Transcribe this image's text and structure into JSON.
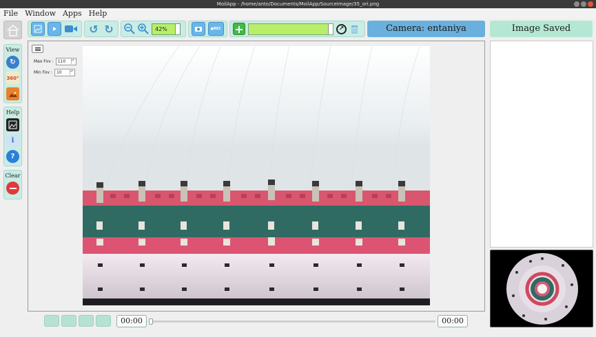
{
  "window": {
    "title": "MoilApp - /home/anto/Documents/MoilApp/SourceImage/35_ori.png"
  },
  "menubar": [
    "File",
    "Window",
    "Apps",
    "Help"
  ],
  "toolbar": {
    "zoom_value": "42%",
    "combo_value": ""
  },
  "camera_label": "Camera: entaniya",
  "image_saved_label": "Image Saved",
  "sidebar": {
    "view_title": "View",
    "help_title": "Help",
    "clear_title": "Clear",
    "panorama_badge": "360°"
  },
  "fov": {
    "max_label": "Max Fov :",
    "max_value": "110",
    "min_label": "Min Fov :",
    "min_value": "10"
  },
  "player": {
    "current_time": "00:00",
    "total_time": "00:00",
    "progress": 0
  },
  "colors": {
    "accent_blue": "#6ab0dd",
    "toolbar_bg": "#c9ece4",
    "saved_bg": "#b5e8d4",
    "combo_green": "#b8ee6a"
  }
}
